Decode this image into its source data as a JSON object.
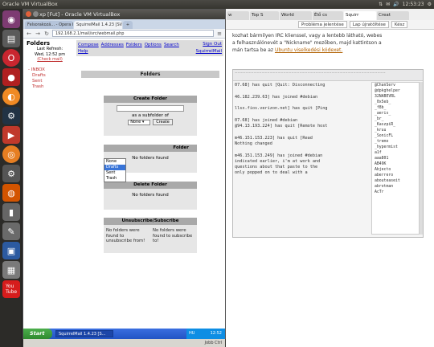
{
  "topbar": {
    "title": "Oracle VM VirtualBox",
    "clock": "12:53:23"
  },
  "launcher": {
    "items": [
      "ubuntu-icon",
      "files-icon",
      "opera-icon",
      "red-app-icon",
      "firefox-icon",
      "steam-icon",
      "app-icon",
      "virtualbox-icon",
      "workspaces-icon",
      "youtube-icon"
    ]
  },
  "vbox": {
    "title": "xp [Fut] - Oracle VM VirtualBox",
    "status_right": "Jobb Ctrl"
  },
  "guest_browser": {
    "tabs": [
      "Felsorakozá... - Opera Felhaszn.",
      "SquirrelMail 1.4.23 [SVN]"
    ],
    "url": "192.168.2.1/mail/src/webmail.php"
  },
  "squirrelmail": {
    "left": {
      "title": "Folders",
      "last_refresh_label": "Last Refresh:",
      "last_refresh_time": "Wed, 12:52 pm",
      "check_mail": "(Check mail)",
      "folders": [
        "INBOX",
        "Drafts",
        "Sent",
        "Trash"
      ]
    },
    "menu": {
      "links": [
        "Compose",
        "Addresses",
        "Folders",
        "Options",
        "Search"
      ],
      "help": "Help",
      "sign_out": "Sign Out",
      "brand": "SquirrelMail"
    },
    "banner": "Folders",
    "create": {
      "title": "Create Folder",
      "subfolder_label": "as a subfolder of",
      "selected_parent": "None",
      "button": "Create",
      "options": [
        "None",
        "Drafts",
        "Sent",
        "Trash"
      ]
    },
    "rename": {
      "title_partial": "Folder",
      "body": "No folders found"
    },
    "delete": {
      "title": "Delete Folder",
      "body": "No folders found"
    },
    "unsubscribe": {
      "title": "Unsubscribe/Subscribe",
      "left_text": "No folders were found to unsubscribe from!",
      "right_text": "No folders were found to subscribe to!"
    }
  },
  "guest_taskbar": {
    "start": "Start",
    "task": "SquirrelMail 1.4.23 [S...",
    "lang": "HU",
    "clock": "12:52"
  },
  "host_browser": {
    "tabs": [
      "w",
      "Top S",
      "World",
      "Élő cs",
      "Squirr",
      "Creat"
    ],
    "toolbar": [
      "Probléma jelentése",
      "Lap újratöltése",
      "Kész"
    ],
    "text_lines": [
      "kozhat bármilyen IRC klienssel, vagy a lentebb látható, webes",
      "a felhasználónevét a \"Nickname\" mezőben, majd kattintson a",
      "mán tartsa be az"
    ],
    "text_link": "Ubuntu viselkedési kódexet.",
    "irc_log": [
      "07.68] has quit [Quit: Disconnecting",
      "",
      "46.182.239.63] has joined #debian",
      "",
      "llsx.fios.verizon.net] has quit [Ping",
      "",
      "07.68] has joined #debian",
      "@94.13.193.224] has quit [Remote host",
      "",
      "m46.151.153.223] has quit [Read",
      "Nothing changed",
      "",
      "m46.151.153.249] has joined #debian",
      "indicated earlier, i'm at work and",
      "questions about that paste to the",
      "only popped on to deal with a"
    ],
    "irc_users": [
      "@ChanServ",
      "@dpkghelper",
      "32NABEVRL",
      "_0x5eb_",
      "_f8b_",
      "_aeris_",
      "_br_",
      "_KaszpiR_",
      "_kruu",
      "_SonicFL",
      "_tremo",
      "_hypermist",
      "a1f",
      "aaa801",
      "AB49K",
      "Abjecto",
      "aberrero",
      "abouteaseit",
      "abrotman",
      "AcTr"
    ]
  }
}
